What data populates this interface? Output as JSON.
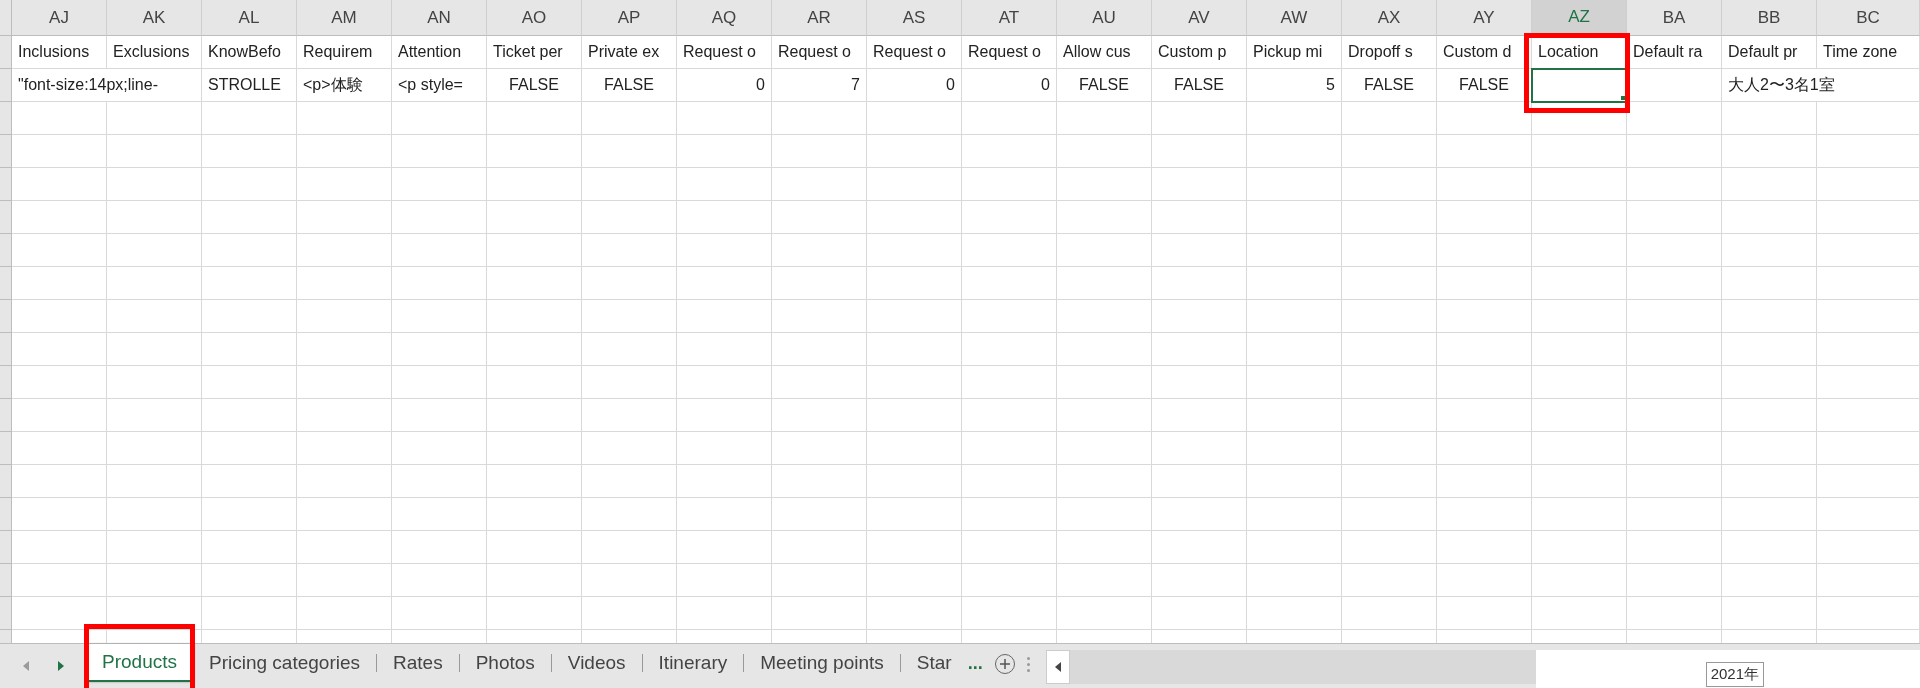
{
  "columns": [
    {
      "label": "AJ",
      "selected": false,
      "highlighted": false
    },
    {
      "label": "AK",
      "selected": false,
      "highlighted": false
    },
    {
      "label": "AL",
      "selected": false,
      "highlighted": false
    },
    {
      "label": "AM",
      "selected": false,
      "highlighted": false
    },
    {
      "label": "AN",
      "selected": false,
      "highlighted": false
    },
    {
      "label": "AO",
      "selected": false,
      "highlighted": false
    },
    {
      "label": "AP",
      "selected": false,
      "highlighted": false
    },
    {
      "label": "AQ",
      "selected": false,
      "highlighted": false
    },
    {
      "label": "AR",
      "selected": false,
      "highlighted": false
    },
    {
      "label": "AS",
      "selected": false,
      "highlighted": false
    },
    {
      "label": "AT",
      "selected": false,
      "highlighted": false
    },
    {
      "label": "AU",
      "selected": false,
      "highlighted": false
    },
    {
      "label": "AV",
      "selected": false,
      "highlighted": false
    },
    {
      "label": "AW",
      "selected": false,
      "highlighted": false
    },
    {
      "label": "AX",
      "selected": false,
      "highlighted": false
    },
    {
      "label": "AY",
      "selected": false,
      "highlighted": false
    },
    {
      "label": "AZ",
      "selected": true,
      "highlighted": true
    },
    {
      "label": "BA",
      "selected": false,
      "highlighted": false
    },
    {
      "label": "BB",
      "selected": false,
      "highlighted": false
    },
    {
      "label": "BC",
      "selected": false,
      "highlighted": false
    }
  ],
  "rows": [
    {
      "cells": [
        {
          "text": "Inclusions",
          "kind": "text",
          "selected": false
        },
        {
          "text": "Exclusions",
          "kind": "text",
          "selected": false
        },
        {
          "text": "KnowBefo",
          "kind": "text",
          "selected": false
        },
        {
          "text": "Requirem",
          "kind": "text",
          "selected": false
        },
        {
          "text": "Attention",
          "kind": "text",
          "selected": false
        },
        {
          "text": "Ticket per",
          "kind": "text",
          "selected": false
        },
        {
          "text": "Private ex",
          "kind": "text",
          "selected": false
        },
        {
          "text": "Request o",
          "kind": "text",
          "selected": false
        },
        {
          "text": "Request o",
          "kind": "text",
          "selected": false
        },
        {
          "text": "Request o",
          "kind": "text",
          "selected": false
        },
        {
          "text": "Request o",
          "kind": "text",
          "selected": false
        },
        {
          "text": "Allow cus",
          "kind": "text",
          "selected": false
        },
        {
          "text": "Custom p",
          "kind": "text",
          "selected": false
        },
        {
          "text": "Pickup mi",
          "kind": "text",
          "selected": false
        },
        {
          "text": "Dropoff s",
          "kind": "text",
          "selected": false
        },
        {
          "text": "Custom d",
          "kind": "text",
          "selected": false
        },
        {
          "text": "Location",
          "kind": "text",
          "selected": false
        },
        {
          "text": "Default ra",
          "kind": "text",
          "selected": false
        },
        {
          "text": "Default pr",
          "kind": "text",
          "selected": false
        },
        {
          "text": "Time zone",
          "kind": "text",
          "selected": false
        }
      ]
    },
    {
      "cells": [
        {
          "text": "\"font-size:14px;line-",
          "kind": "text",
          "selected": false
        },
        {
          "kind": "text",
          "selected": false
        },
        {
          "text": "STROLLE",
          "kind": "text",
          "selected": false
        },
        {
          "text": "<p>体験",
          "kind": "text",
          "selected": false
        },
        {
          "text": "<p style=",
          "kind": "text",
          "selected": false
        },
        {
          "text": "FALSE",
          "kind": "boolean",
          "selected": false
        },
        {
          "text": "FALSE",
          "kind": "boolean",
          "selected": false
        },
        {
          "text": "0",
          "kind": "number",
          "selected": false
        },
        {
          "text": "7",
          "kind": "number",
          "selected": false
        },
        {
          "text": "0",
          "kind": "number",
          "selected": false
        },
        {
          "text": "0",
          "kind": "number",
          "selected": false
        },
        {
          "text": "FALSE",
          "kind": "boolean",
          "selected": false
        },
        {
          "text": "FALSE",
          "kind": "boolean",
          "selected": false
        },
        {
          "text": "5",
          "kind": "number",
          "selected": false
        },
        {
          "text": "FALSE",
          "kind": "boolean",
          "selected": false
        },
        {
          "text": "FALSE",
          "kind": "boolean",
          "selected": false
        },
        {
          "kind": "text",
          "selected": true
        },
        {
          "kind": "text",
          "selected": false
        },
        {
          "text": "大人2〜3名1室",
          "kind": "text",
          "selected": false
        },
        {
          "kind": "text",
          "selected": false
        }
      ]
    }
  ],
  "sheets": [
    {
      "label": "Products",
      "selected": true,
      "highlighted": true
    },
    {
      "label": "Pricing categories",
      "selected": false,
      "highlighted": false
    },
    {
      "label": "Rates",
      "selected": false,
      "highlighted": false
    },
    {
      "label": "Photos",
      "selected": false,
      "highlighted": false
    },
    {
      "label": "Videos",
      "selected": false,
      "highlighted": false
    },
    {
      "label": "Itinerary",
      "selected": false,
      "highlighted": false
    },
    {
      "label": "Meeting points",
      "selected": false,
      "highlighted": false
    },
    {
      "label": "Star",
      "selected": false,
      "highlighted": false
    }
  ],
  "more_sheets": "...",
  "status_date": "2021年"
}
